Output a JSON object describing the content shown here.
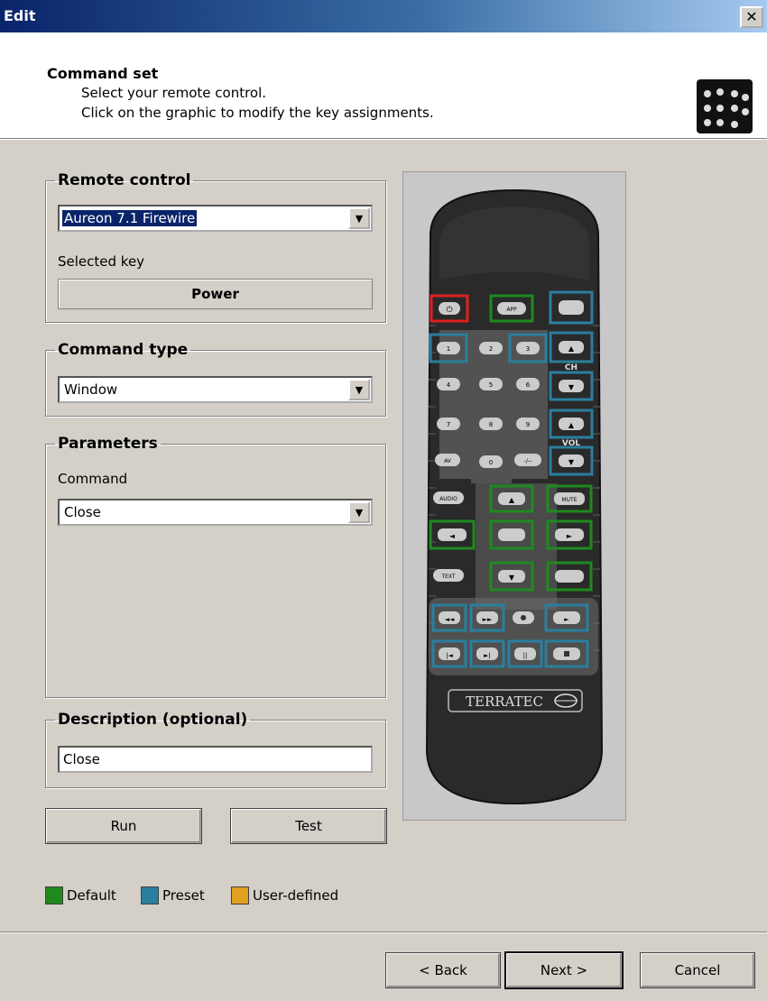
{
  "window": {
    "title": "Edit",
    "close_glyph": "✕"
  },
  "header": {
    "title": "Command set",
    "line1": "Select your remote control.",
    "line2": "Click on the graphic to modify the key assignments.",
    "icon": "remote-thumbnail-icon"
  },
  "remote_control": {
    "legend": "Remote control",
    "selected": "Aureon 7.1 Firewire",
    "selected_key_label": "Selected key",
    "selected_key": "Power"
  },
  "command_type": {
    "legend": "Command type",
    "selected": "Window"
  },
  "parameters": {
    "legend": "Parameters",
    "command_label": "Command",
    "command_value": "Close"
  },
  "description": {
    "legend": "Description (optional)",
    "value": "Close"
  },
  "buttons": {
    "run": "Run",
    "test": "Test",
    "back": "< Back",
    "next": "Next >",
    "cancel": "Cancel"
  },
  "legend": {
    "default": {
      "label": "Default",
      "color": "#1e8a1e"
    },
    "preset": {
      "label": "Preset",
      "color": "#2a7f9e"
    },
    "user": {
      "label": "User-defined",
      "color": "#e0a020"
    }
  },
  "remote": {
    "brand": "TERRATEC",
    "ch_label": "CH",
    "vol_label": "VOL",
    "selected_color": "#e02020"
  }
}
